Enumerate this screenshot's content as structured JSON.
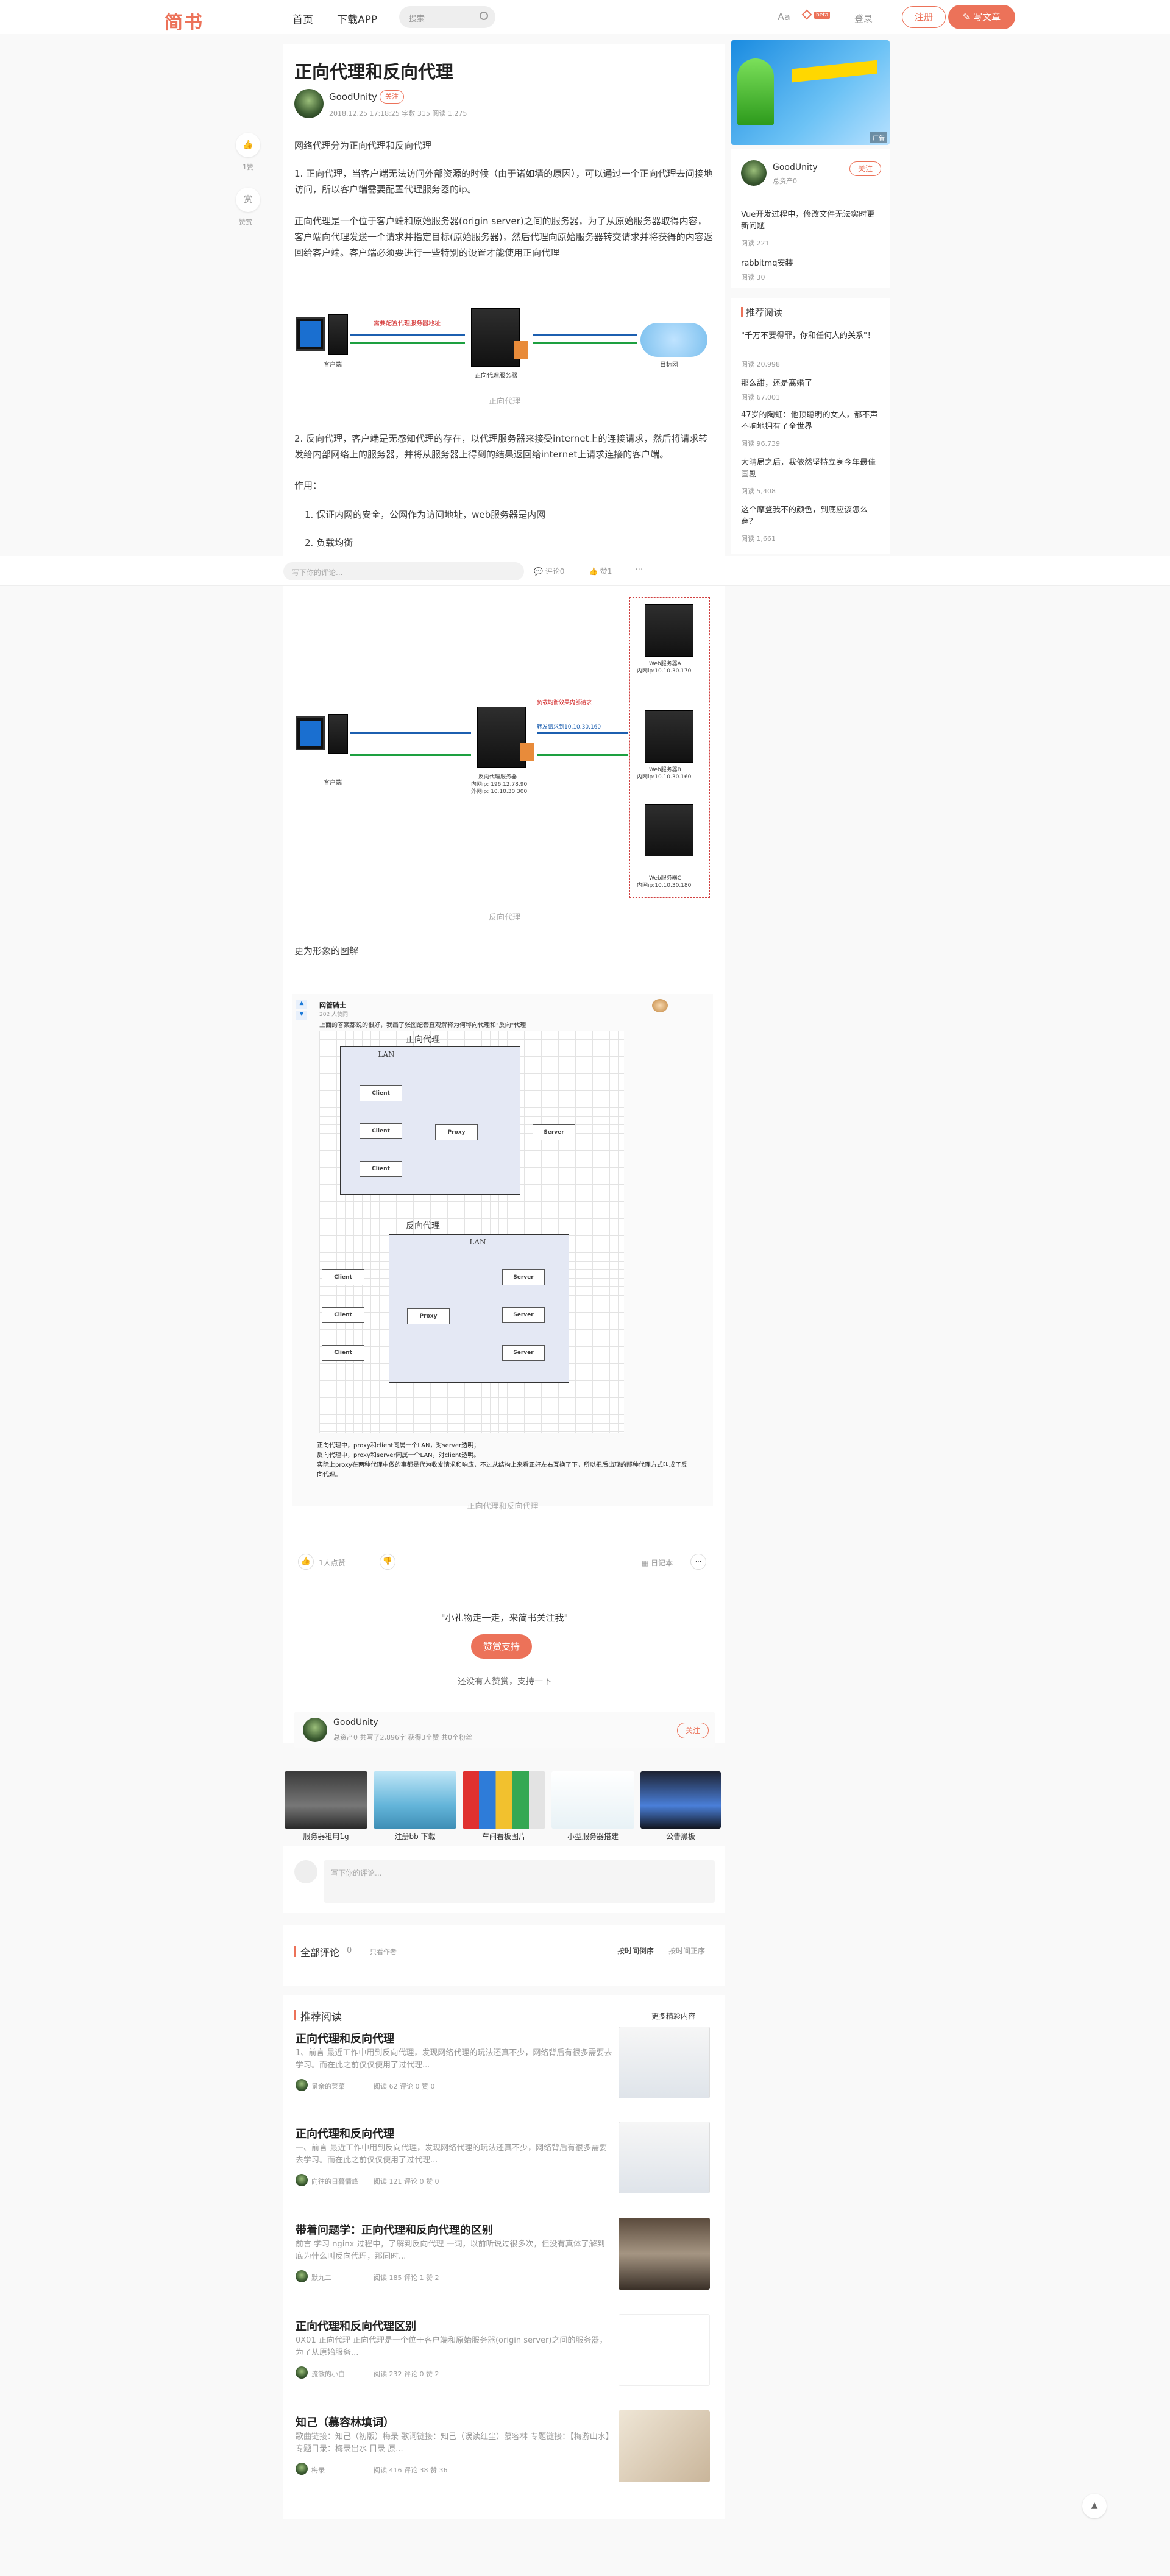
{
  "header": {
    "logo": "简书",
    "nav_home": "首页",
    "nav_app": "下载APP",
    "search_placeholder": "搜索",
    "font_toggle": "Aa",
    "beta_badge": "beta",
    "login": "登录",
    "register": "注册",
    "write": "写文章"
  },
  "article": {
    "title": "正向代理和反向代理",
    "author": "GoodUnity",
    "follow": "关注",
    "meta": "2018.12.25 17:18:25 字数 315 阅读 1,275",
    "p1": "网络代理分为正向代理和反向代理",
    "p2": "1. 正向代理，当客户端无法访问外部资源的时候（由于诸如墙的原因），可以通过一个正向代理去间接地访问，所以客户端需要配置代理服务器的ip。",
    "p3": "正向代理是一个位于客户端和原始服务器(origin server)之间的服务器，为了从原始服务器取得内容，客户端向代理发送一个请求并指定目标(原始服务器)，然后代理向原始服务器转交请求并将获得的内容返回给客户端。客户端必须要进行一些特别的设置才能使用正向代理",
    "fig1_caption": "正向代理",
    "fig1_label_client": "客户端",
    "fig1_label_proxy": "正向代理服务器",
    "fig1_label_target": "目标网",
    "fig1_arrow_label": "需要配置代理服务器地址",
    "p4": "2. 反向代理，客户端是无感知代理的存在，以代理服务器来接受internet上的连接请求，然后将请求转发给内部网络上的服务器，并将从服务器上得到的结果返回给internet上请求连接的客户端。",
    "p5": "作用：",
    "li1": "1. 保证内网的安全，公网作为访问地址，web服务器是内网",
    "li2": "2. 负载均衡",
    "fig2_caption": "反向代理",
    "fig2_label_client": "客户端",
    "fig2_label_proxy": "反向代理服务器",
    "fig2_proxy_ip1": "内网ip: 196.12.78.90",
    "fig2_proxy_ip2": "外网ip: 10.10.30.300",
    "fig2_lb_label": "负载均衡效果内部请求",
    "fig2_forward_label": "转发请求到10.10.30.160",
    "fig2_server_a": "Web服务器A",
    "fig2_server_a_ip": "内网ip:10.10.30.170",
    "fig2_server_b": "Web服务器B",
    "fig2_server_b_ip": "内网ip:10.10.30.160",
    "fig2_server_c": "Web服务器C",
    "fig2_server_c_ip": "内网ip:10.10.30.180",
    "p6": "更为形象的图解",
    "fig3_author": "网管骑士",
    "fig3_votes": "202 人赞同",
    "fig3_lead": "上面的答案都说的很好，我画了张图配套直观解释为何称向代理和\"反向\"代理",
    "fig3_title1": "正向代理",
    "fig3_title2": "反向代理",
    "fig3_lan": "LAN",
    "fig3_client": "Client",
    "fig3_proxy": "Proxy",
    "fig3_server": "Server",
    "fig3_note1": "正向代理中，proxy和client同属一个LAN，对server透明；",
    "fig3_note2": "反向代理中，proxy和server同属一个LAN，对client透明。",
    "fig3_note3": "实际上proxy在两种代理中做的事都是代为收发请求和响应，不过从结构上来看正好左右互换了下，所以把后出现的那种代理方式叫成了反向代理。",
    "fig3_caption": "正向代理和反向代理",
    "like_count": "1人点赞",
    "diary": "日记本",
    "donate_quote": "\"小礼物走一走，来简书关注我\"",
    "donate_btn": "赞赏支持",
    "donate_note": "还没有人赞赏，支持一下",
    "author_stats": "总资产0  共写了2,896字  获得3个赞  共0个粉丝"
  },
  "sidebar": {
    "author": "GoodUnity",
    "author_sub": "总资产0",
    "follow": "关注",
    "items": [
      {
        "title": "Vue开发过程中，修改文件无法实时更新问题",
        "meta": "阅读 221"
      },
      {
        "title": "rabbitmq安装",
        "meta": "阅读 30"
      }
    ],
    "rec_title": "推荐阅读",
    "recs": [
      {
        "title": "\"千万不要得罪，你和任何人的关系\"！",
        "meta": "阅读 20,998"
      },
      {
        "title": "那么甜，还是离婚了",
        "meta": "阅读 67,001"
      },
      {
        "title": "47岁的陶虹：他顶聪明的女人，都不声不响地拥有了全世界",
        "meta": "阅读 96,739"
      },
      {
        "title": "大晴局之后，我依然坚持立身今年最佳国剧",
        "meta": "阅读 5,408"
      },
      {
        "title": "这个摩登我不的颜色，到底应该怎么穿？",
        "meta": "阅读 1,661"
      }
    ],
    "ad_badge": "广告"
  },
  "sticky": {
    "comment_placeholder": "写下你的评论...",
    "comment_count": "评论0",
    "like_count": "赞1",
    "more": "···"
  },
  "ads": [
    {
      "label": "服务器租用1g"
    },
    {
      "label": "注册bb 下载"
    },
    {
      "label": "车间看板图片"
    },
    {
      "label": "小型服务器搭建"
    },
    {
      "label": "公告黑板"
    }
  ],
  "comments": {
    "placeholder": "写下你的评论...",
    "all_title": "全部评论",
    "count": "0",
    "author_only": "只看作者",
    "sort_time": "按时间倒序",
    "sort_time2": "按时间正序"
  },
  "recommend": {
    "title": "推荐阅读",
    "more": "更多精彩内容",
    "items": [
      {
        "title": "正向代理和反向代理",
        "desc": "1、前言 最近工作中用到反向代理，发现网络代理的玩法还真不少，网络背后有很多需要去学习。而在此之前仅仅使用了过代理...",
        "author": "景余的菜菜",
        "stats": "阅读 62  评论 0  赞 0"
      },
      {
        "title": "正向代理和反向代理",
        "desc": "一、前言 最近工作中用到反向代理，发现网络代理的玩法还真不少，网络背后有很多需要去学习。而在此之前仅仅使用了过代理...",
        "author": "向往的日暮情峰",
        "stats": "阅读 121  评论 0  赞 0"
      },
      {
        "title": "带着问题学：正向代理和反向代理的区别",
        "desc": "前言 学习 nginx 过程中，了解到反向代理 一词，以前听说过很多次，但没有真体了解到底为什么叫反向代理，那同时...",
        "author": "默九二",
        "stats": "阅读 185  评论 1  赞 2"
      },
      {
        "title": "正向代理和反向代理区别",
        "desc": "0X01 正向代理 正向代理是一个位于客户端和原始服务器(origin server)之间的服务器，为了从原始服务...",
        "author": "流敏的小白",
        "stats": "阅读 232  评论 0  赞 2"
      },
      {
        "title": "知己（慕容林填词）",
        "desc": "歌曲链接：知己（初版）梅录 歌词链接：知己（误读红尘）慕容林 专题链接：【梅游山水】专题目录：梅录出水 目录 原...",
        "author": "梅录",
        "stats": "阅读 416  评论 38  赞 36"
      }
    ]
  },
  "colors": {
    "accent": "#ec7259",
    "bg": "#f9f9f9"
  }
}
